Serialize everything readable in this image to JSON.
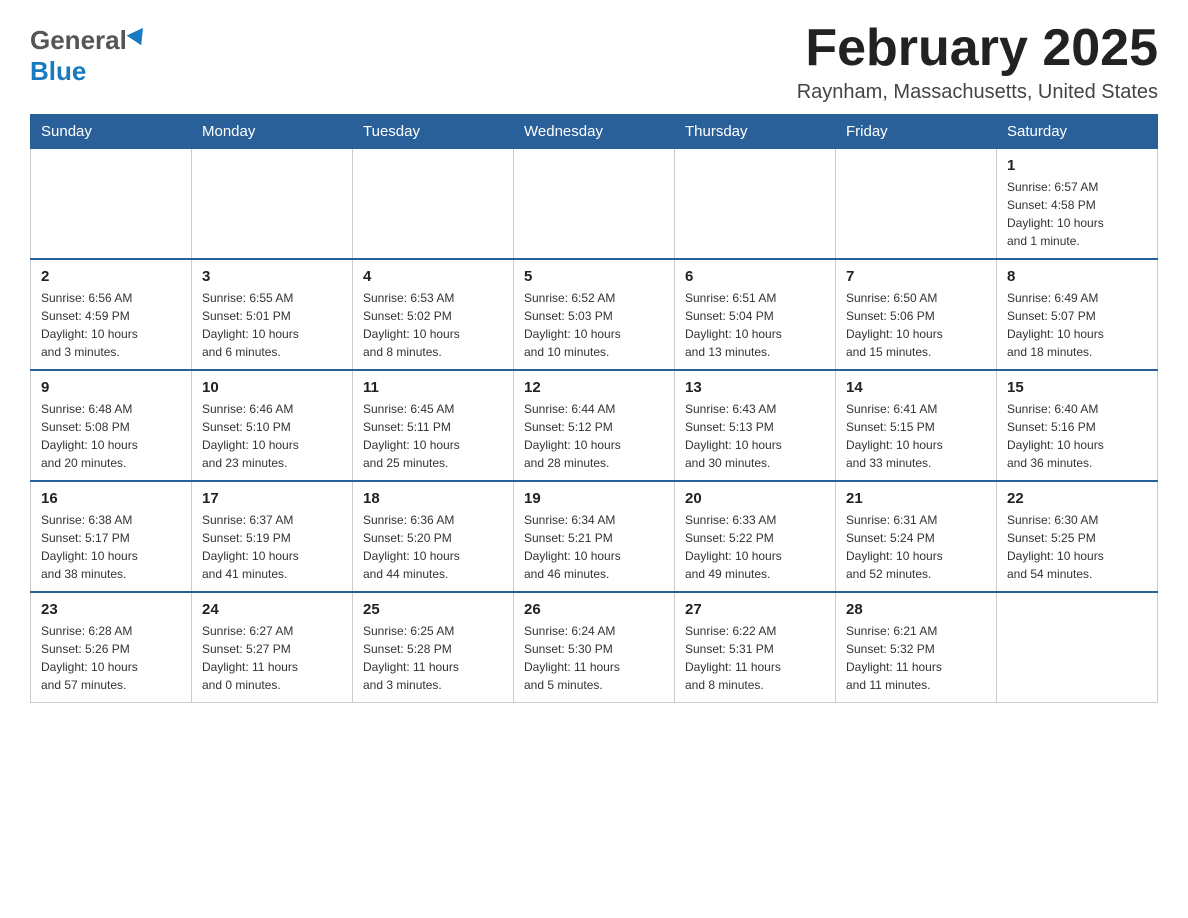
{
  "header": {
    "logo_general": "General",
    "logo_blue": "Blue",
    "title": "February 2025",
    "location": "Raynham, Massachusetts, United States"
  },
  "days_of_week": [
    "Sunday",
    "Monday",
    "Tuesday",
    "Wednesday",
    "Thursday",
    "Friday",
    "Saturday"
  ],
  "weeks": [
    {
      "days": [
        {
          "num": "",
          "info": ""
        },
        {
          "num": "",
          "info": ""
        },
        {
          "num": "",
          "info": ""
        },
        {
          "num": "",
          "info": ""
        },
        {
          "num": "",
          "info": ""
        },
        {
          "num": "",
          "info": ""
        },
        {
          "num": "1",
          "info": "Sunrise: 6:57 AM\nSunset: 4:58 PM\nDaylight: 10 hours\nand 1 minute."
        }
      ]
    },
    {
      "days": [
        {
          "num": "2",
          "info": "Sunrise: 6:56 AM\nSunset: 4:59 PM\nDaylight: 10 hours\nand 3 minutes."
        },
        {
          "num": "3",
          "info": "Sunrise: 6:55 AM\nSunset: 5:01 PM\nDaylight: 10 hours\nand 6 minutes."
        },
        {
          "num": "4",
          "info": "Sunrise: 6:53 AM\nSunset: 5:02 PM\nDaylight: 10 hours\nand 8 minutes."
        },
        {
          "num": "5",
          "info": "Sunrise: 6:52 AM\nSunset: 5:03 PM\nDaylight: 10 hours\nand 10 minutes."
        },
        {
          "num": "6",
          "info": "Sunrise: 6:51 AM\nSunset: 5:04 PM\nDaylight: 10 hours\nand 13 minutes."
        },
        {
          "num": "7",
          "info": "Sunrise: 6:50 AM\nSunset: 5:06 PM\nDaylight: 10 hours\nand 15 minutes."
        },
        {
          "num": "8",
          "info": "Sunrise: 6:49 AM\nSunset: 5:07 PM\nDaylight: 10 hours\nand 18 minutes."
        }
      ]
    },
    {
      "days": [
        {
          "num": "9",
          "info": "Sunrise: 6:48 AM\nSunset: 5:08 PM\nDaylight: 10 hours\nand 20 minutes."
        },
        {
          "num": "10",
          "info": "Sunrise: 6:46 AM\nSunset: 5:10 PM\nDaylight: 10 hours\nand 23 minutes."
        },
        {
          "num": "11",
          "info": "Sunrise: 6:45 AM\nSunset: 5:11 PM\nDaylight: 10 hours\nand 25 minutes."
        },
        {
          "num": "12",
          "info": "Sunrise: 6:44 AM\nSunset: 5:12 PM\nDaylight: 10 hours\nand 28 minutes."
        },
        {
          "num": "13",
          "info": "Sunrise: 6:43 AM\nSunset: 5:13 PM\nDaylight: 10 hours\nand 30 minutes."
        },
        {
          "num": "14",
          "info": "Sunrise: 6:41 AM\nSunset: 5:15 PM\nDaylight: 10 hours\nand 33 minutes."
        },
        {
          "num": "15",
          "info": "Sunrise: 6:40 AM\nSunset: 5:16 PM\nDaylight: 10 hours\nand 36 minutes."
        }
      ]
    },
    {
      "days": [
        {
          "num": "16",
          "info": "Sunrise: 6:38 AM\nSunset: 5:17 PM\nDaylight: 10 hours\nand 38 minutes."
        },
        {
          "num": "17",
          "info": "Sunrise: 6:37 AM\nSunset: 5:19 PM\nDaylight: 10 hours\nand 41 minutes."
        },
        {
          "num": "18",
          "info": "Sunrise: 6:36 AM\nSunset: 5:20 PM\nDaylight: 10 hours\nand 44 minutes."
        },
        {
          "num": "19",
          "info": "Sunrise: 6:34 AM\nSunset: 5:21 PM\nDaylight: 10 hours\nand 46 minutes."
        },
        {
          "num": "20",
          "info": "Sunrise: 6:33 AM\nSunset: 5:22 PM\nDaylight: 10 hours\nand 49 minutes."
        },
        {
          "num": "21",
          "info": "Sunrise: 6:31 AM\nSunset: 5:24 PM\nDaylight: 10 hours\nand 52 minutes."
        },
        {
          "num": "22",
          "info": "Sunrise: 6:30 AM\nSunset: 5:25 PM\nDaylight: 10 hours\nand 54 minutes."
        }
      ]
    },
    {
      "days": [
        {
          "num": "23",
          "info": "Sunrise: 6:28 AM\nSunset: 5:26 PM\nDaylight: 10 hours\nand 57 minutes."
        },
        {
          "num": "24",
          "info": "Sunrise: 6:27 AM\nSunset: 5:27 PM\nDaylight: 11 hours\nand 0 minutes."
        },
        {
          "num": "25",
          "info": "Sunrise: 6:25 AM\nSunset: 5:28 PM\nDaylight: 11 hours\nand 3 minutes."
        },
        {
          "num": "26",
          "info": "Sunrise: 6:24 AM\nSunset: 5:30 PM\nDaylight: 11 hours\nand 5 minutes."
        },
        {
          "num": "27",
          "info": "Sunrise: 6:22 AM\nSunset: 5:31 PM\nDaylight: 11 hours\nand 8 minutes."
        },
        {
          "num": "28",
          "info": "Sunrise: 6:21 AM\nSunset: 5:32 PM\nDaylight: 11 hours\nand 11 minutes."
        },
        {
          "num": "",
          "info": ""
        }
      ]
    }
  ]
}
